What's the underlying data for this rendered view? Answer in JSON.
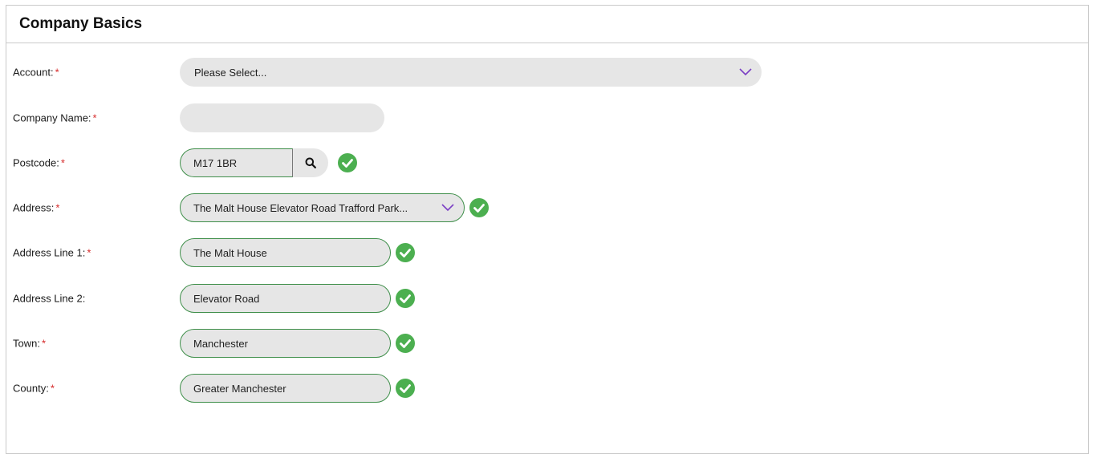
{
  "section": {
    "title": "Company Basics"
  },
  "required_marker": "*",
  "fields": {
    "account": {
      "label": "Account:",
      "value": "Please Select...",
      "required": true
    },
    "company_name": {
      "label": "Company Name:",
      "value": "",
      "required": true
    },
    "postcode": {
      "label": "Postcode:",
      "value": "M17 1BR",
      "required": true
    },
    "address": {
      "label": "Address:",
      "value": "The Malt House Elevator Road Trafford Park...",
      "required": true
    },
    "address_line_1": {
      "label": "Address Line 1:",
      "value": "The Malt House",
      "required": true
    },
    "address_line_2": {
      "label": "Address Line 2:",
      "value": "Elevator Road",
      "required": false
    },
    "town": {
      "label": "Town:",
      "value": "Manchester",
      "required": true
    },
    "county": {
      "label": "County:",
      "value": "Greater Manchester",
      "required": true
    }
  },
  "colors": {
    "required": "#d62b2b",
    "valid_border": "#3f8f4a",
    "valid_icon": "#4caf50",
    "chevron": "#7b3fc4",
    "field_bg": "#e6e6e6"
  },
  "icons": {
    "valid": "check-circle-icon",
    "dropdown": "chevron-down-icon",
    "search": "search-icon"
  }
}
